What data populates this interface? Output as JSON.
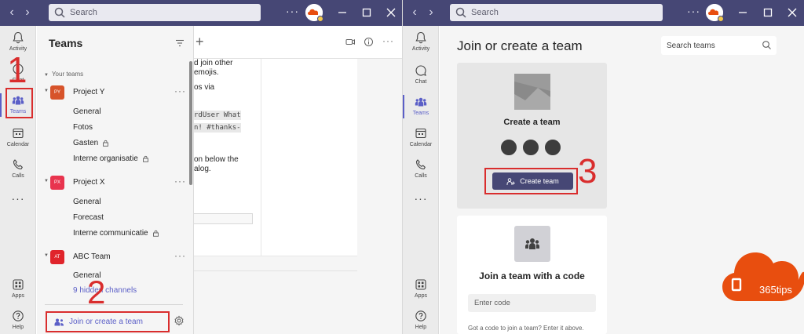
{
  "left_window": {
    "search_placeholder": "Search",
    "rail": {
      "activity": "Activity",
      "chat": "Chat",
      "teams": "Teams",
      "calendar": "Calendar",
      "calls": "Calls",
      "apps": "Apps",
      "help": "Help"
    },
    "teams_panel": {
      "title": "Teams",
      "section_label": "Your teams",
      "teams": [
        {
          "initials": "PY",
          "name": "Project Y",
          "color": "#d7532a",
          "channels": [
            {
              "name": "General",
              "private": false
            },
            {
              "name": "Fotos",
              "private": false
            },
            {
              "name": "Gasten",
              "private": true
            },
            {
              "name": "Interne organisatie",
              "private": true
            }
          ]
        },
        {
          "initials": "PX",
          "name": "Project X",
          "color": "#e8344e",
          "channels": [
            {
              "name": "General",
              "private": false
            },
            {
              "name": "Forecast",
              "private": false
            },
            {
              "name": "Interne communicatie",
              "private": true
            }
          ]
        },
        {
          "initials": "AT",
          "name": "ABC Team",
          "color": "#e0242b",
          "channels": [
            {
              "name": "General",
              "private": false
            },
            {
              "name": "9 hidden channels",
              "private": false
            }
          ]
        }
      ],
      "join_link": "Join or create a team"
    },
    "chat_fragments": [
      "d join other",
      "emojis.",
      "os via",
      "rdUser What",
      "n! #thanks-",
      "on below the",
      "alog."
    ]
  },
  "right_window": {
    "search_placeholder": "Search",
    "page_title": "Join or create a team",
    "search_teams_placeholder": "Search teams",
    "create_card": {
      "title": "Create a team",
      "button": "Create team"
    },
    "join_card": {
      "title": "Join a team with a code",
      "code_placeholder": "Enter code",
      "help": "Got a code to join a team? Enter it above."
    }
  },
  "annotations": {
    "step1": "1",
    "step2": "2",
    "step3": "3",
    "brand": "365tips"
  },
  "colors": {
    "titlebar": "#464775",
    "accent": "#5b5fc7",
    "annotation": "#d92d2d",
    "brand": "#e84e0f"
  }
}
